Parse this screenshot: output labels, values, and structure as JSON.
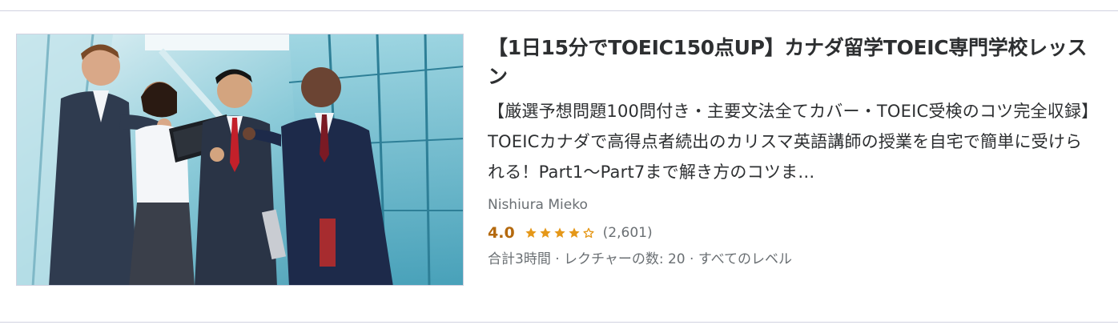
{
  "course": {
    "title": "【1日15分でTOEIC150点UP】カナダ留学TOEIC専門学校レッスン",
    "headline": "【厳選予想問題100問付き・主要文法全てカバー・TOEIC受検のコツ完全収録】TOEICカナダで高得点者続出のカリスマ英語講師の授業を自宅で簡単に受けられる！Part1〜Part7まで解き方のコツま…",
    "instructor": "Nishiura Mieko",
    "rating": "4.0",
    "rating_value": 4.0,
    "star_icons": [
      "star-full-icon",
      "star-full-icon",
      "star-full-icon",
      "star-full-icon",
      "star-empty-icon"
    ],
    "rating_count": "(2,601)",
    "meta": "合計3時間 · レクチャーの数: 20 · すべてのレベル",
    "image_icon": "business-team-photo"
  },
  "colors": {
    "text": "#2d2f31",
    "muted": "#6a6f73",
    "rating": "#b4690e",
    "star": "#e59819",
    "divider": "#d1d2e0"
  }
}
